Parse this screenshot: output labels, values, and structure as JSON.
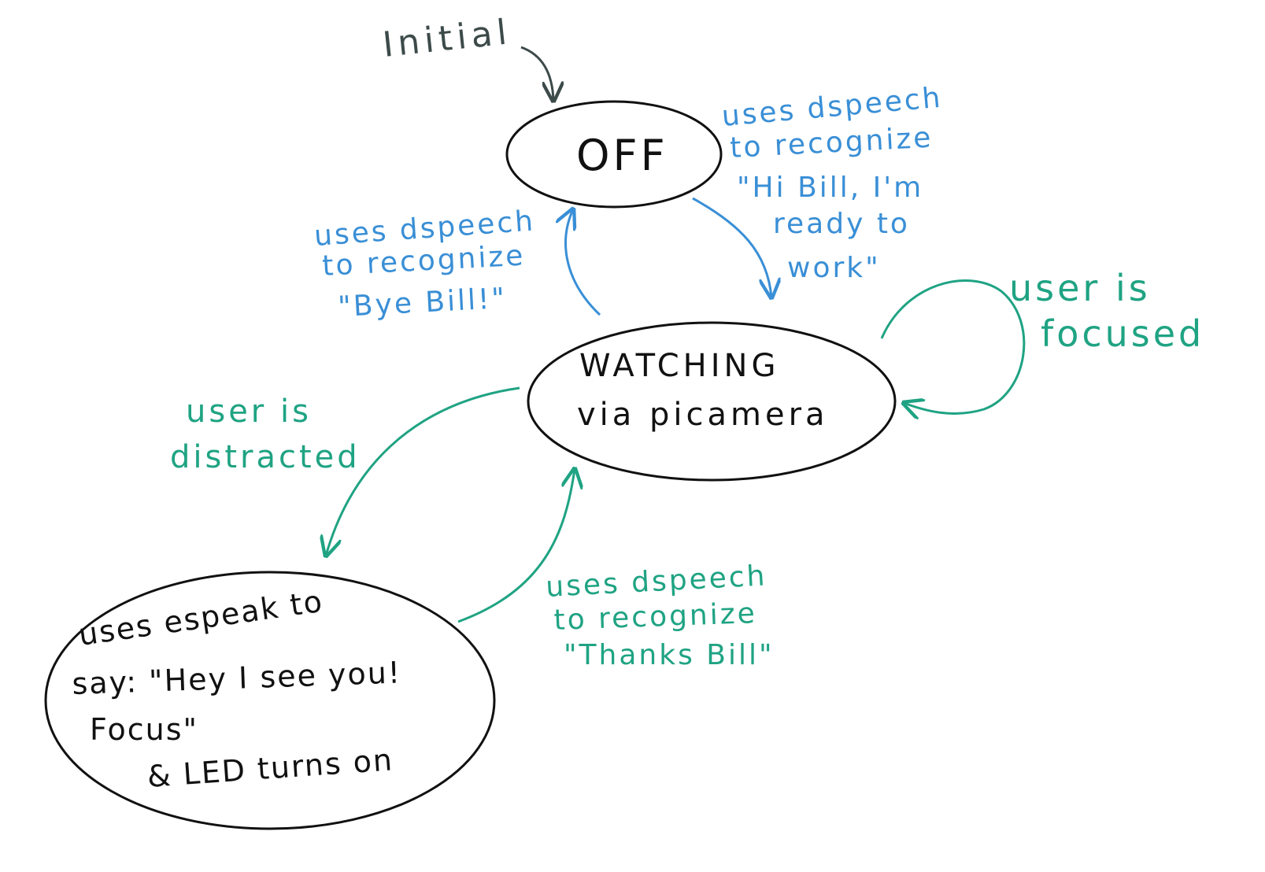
{
  "colors": {
    "ink": "#111111",
    "grey": "#3d4a4a",
    "blue": "#3a8fd6",
    "green": "#1fa383"
  },
  "initial_label": "Initial",
  "states": {
    "off": {
      "label": "OFF"
    },
    "watching": {
      "line1": "WATCHING",
      "line2": "via picamera"
    },
    "alert": {
      "line1": "uses espeak  to",
      "line2": "say: \"Hey I see you!",
      "line3": "Focus\"",
      "line4": "& LED turns on"
    }
  },
  "transitions": {
    "off_to_watching": {
      "line1": "uses dspeech",
      "line2": "to recognize",
      "line3": "\"Hi Bill, I'm",
      "line4": "ready to",
      "line5": "work\""
    },
    "watching_to_off": {
      "line1": "uses dspeech",
      "line2": "to recognize",
      "line3": "\"Bye Bill!\""
    },
    "watching_self": {
      "line1": "user is",
      "line2": "focused"
    },
    "watching_to_alert": {
      "line1": "user is",
      "line2": "distracted"
    },
    "alert_to_watching": {
      "line1": "uses dspeech",
      "line2": "to recognize",
      "line3": "\"Thanks Bill\""
    }
  }
}
